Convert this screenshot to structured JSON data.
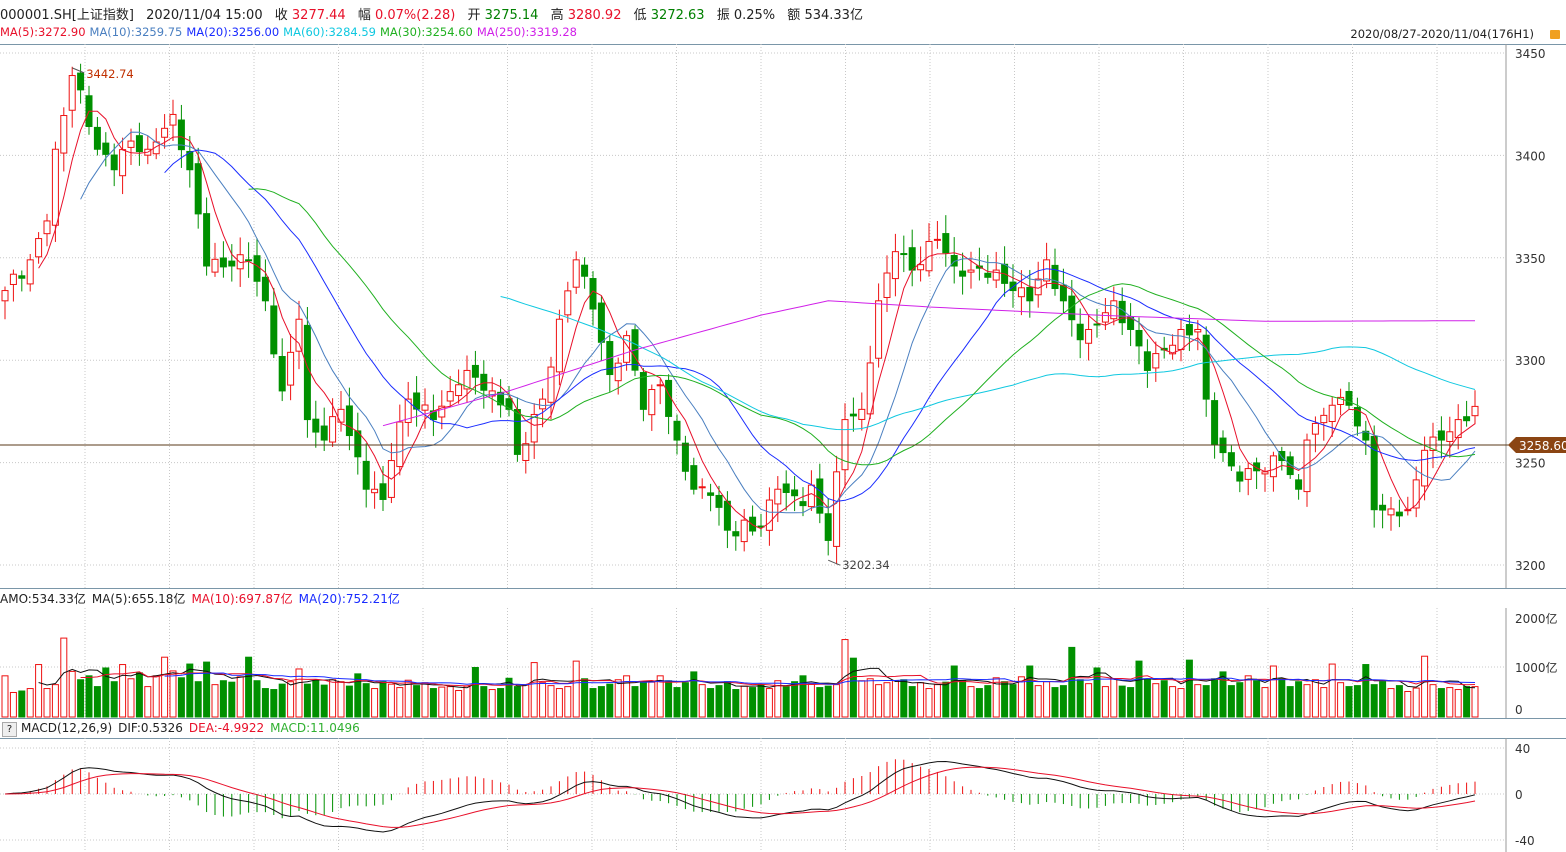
{
  "header": {
    "symbol": "000001.SH[上证指数]",
    "datetime": "2020/11/04 15:00",
    "close_label": "收",
    "close": "3277.44",
    "change_label": "幅",
    "change": "0.07%(2.28)",
    "open_label": "开",
    "open": "3275.14",
    "high_label": "高",
    "high": "3280.92",
    "low_label": "低",
    "low": "3272.63",
    "amp_label": "振",
    "amp": "0.25%",
    "amount_label": "额",
    "amount": "534.33亿"
  },
  "ma_legend": [
    {
      "text": "MA(5):3272.90",
      "color": "#e8102a"
    },
    {
      "text": "MA(10):3259.75",
      "color": "#4a7fc0"
    },
    {
      "text": "MA(20):3256.00",
      "color": "#1a2cff"
    },
    {
      "text": "MA(60):3284.59",
      "color": "#10c8e0"
    },
    {
      "text": "MA(30):3254.60",
      "color": "#20b020"
    },
    {
      "text": "MA(250):3319.28",
      "color": "#d020e8"
    }
  ],
  "range_label": "2020/08/27-2020/11/04(176H1)",
  "current_price_label": "3258.60",
  "current_price": 3258.6,
  "max_marker": {
    "label": "3442.74",
    "bar": 8,
    "price": 3442.74
  },
  "min_marker": {
    "label": "3202.34",
    "bar": 98,
    "price": 3202.34
  },
  "volume_legend": [
    {
      "text": "AMO:534.33亿",
      "color": "#222"
    },
    {
      "text": "MA(5):655.18亿",
      "color": "#222"
    },
    {
      "text": "MA(10):697.87亿",
      "color": "#e8102a"
    },
    {
      "text": "MA(20):752.21亿",
      "color": "#1a2cff"
    }
  ],
  "macd_legend": {
    "help": "?",
    "items": [
      {
        "text": "MACD(12,26,9)",
        "color": "#222"
      },
      {
        "text": "DIF:0.5326",
        "color": "#222"
      },
      {
        "text": "DEA:-4.9922",
        "color": "#e8102a"
      },
      {
        "text": "MACD:11.0496",
        "color": "#30b030"
      }
    ]
  },
  "colors": {
    "up": "#ee1111",
    "down": "#009000",
    "grid": "#c8c8c8",
    "price_tag": "#8b4513"
  },
  "chart_data": {
    "type": "candlestick",
    "bars": 176,
    "price_axis": {
      "ticks": [
        3200,
        3250,
        3300,
        3350,
        3400,
        3450
      ],
      "range": [
        3196,
        3462
      ]
    },
    "volume_axis": {
      "ticks": [
        "0",
        "1000亿",
        "2000亿"
      ],
      "values": [
        0,
        1000,
        2000
      ],
      "max": 2200
    },
    "macd_axis": {
      "ticks": [
        "-40",
        "0",
        "40"
      ],
      "values": [
        -40,
        0,
        40
      ]
    },
    "close_keypoints": [
      [
        0,
        3334
      ],
      [
        3,
        3349
      ],
      [
        5,
        3368
      ],
      [
        6,
        3403
      ],
      [
        8,
        3439
      ],
      [
        9,
        3432
      ],
      [
        11,
        3403
      ],
      [
        13,
        3393
      ],
      [
        15,
        3407
      ],
      [
        17,
        3403
      ],
      [
        20,
        3420
      ],
      [
        22,
        3393
      ],
      [
        24,
        3346
      ],
      [
        27,
        3346
      ],
      [
        29,
        3349
      ],
      [
        31,
        3329
      ],
      [
        33,
        3285
      ],
      [
        35,
        3320
      ],
      [
        36,
        3271
      ],
      [
        38,
        3261
      ],
      [
        40,
        3276
      ],
      [
        43,
        3237
      ],
      [
        45,
        3232
      ],
      [
        46,
        3251
      ],
      [
        48,
        3281
      ],
      [
        51,
        3271
      ],
      [
        54,
        3288
      ],
      [
        55,
        3295
      ],
      [
        58,
        3285
      ],
      [
        60,
        3276
      ],
      [
        61,
        3254
      ],
      [
        64,
        3281
      ],
      [
        66,
        3320
      ],
      [
        68,
        3349
      ],
      [
        70,
        3325
      ],
      [
        72,
        3293
      ],
      [
        74,
        3312
      ],
      [
        76,
        3276
      ],
      [
        78,
        3288
      ],
      [
        80,
        3261
      ],
      [
        82,
        3237
      ],
      [
        84,
        3234
      ],
      [
        86,
        3217
      ],
      [
        90,
        3219
      ],
      [
        92,
        3237
      ],
      [
        95,
        3229
      ],
      [
        96,
        3239
      ],
      [
        98,
        3212
      ],
      [
        100,
        3271
      ],
      [
        102,
        3276
      ],
      [
        104,
        3329
      ],
      [
        106,
        3353
      ],
      [
        108,
        3344
      ],
      [
        111,
        3359
      ],
      [
        113,
        3346
      ],
      [
        115,
        3344
      ],
      [
        118,
        3344
      ],
      [
        120,
        3334
      ],
      [
        122,
        3329
      ],
      [
        124,
        3349
      ],
      [
        126,
        3329
      ],
      [
        128,
        3310
      ],
      [
        129,
        3315
      ],
      [
        132,
        3329
      ],
      [
        134,
        3315
      ],
      [
        136,
        3295
      ],
      [
        138,
        3305
      ],
      [
        140,
        3315
      ],
      [
        142,
        3315
      ],
      [
        143,
        3281
      ],
      [
        144,
        3259
      ],
      [
        147,
        3241
      ],
      [
        149,
        3246
      ],
      [
        152,
        3251
      ],
      [
        154,
        3237
      ],
      [
        155,
        3261
      ],
      [
        158,
        3278
      ],
      [
        160,
        3278
      ],
      [
        162,
        3261
      ],
      [
        163,
        3227
      ],
      [
        166,
        3224
      ],
      [
        167,
        3227
      ],
      [
        169,
        3256
      ],
      [
        171,
        3261
      ],
      [
        173,
        3271
      ],
      [
        175,
        3277.44
      ]
    ],
    "ma250_keypoints": [
      [
        45,
        3268
      ],
      [
        60,
        3285
      ],
      [
        75,
        3305
      ],
      [
        90,
        3322
      ],
      [
        98,
        3329
      ],
      [
        110,
        3326
      ],
      [
        130,
        3322
      ],
      [
        150,
        3319
      ],
      [
        175,
        3319.28
      ]
    ],
    "volume": [
      820,
      480,
      510,
      560,
      1050,
      560,
      640,
      1590,
      910,
      740,
      820,
      600,
      980,
      700,
      1050,
      760,
      880,
      600,
      820,
      1200,
      920,
      780,
      1060,
      700,
      1100,
      640,
      720,
      690,
      800,
      1200,
      720,
      560,
      540,
      650,
      700,
      960,
      650,
      720,
      630,
      740,
      700,
      610,
      860,
      660,
      560,
      700,
      650,
      580,
      730,
      620,
      680,
      560,
      590,
      600,
      520,
      610,
      990,
      600,
      540,
      560,
      770,
      600,
      630,
      1090,
      680,
      620,
      560,
      600,
      1120,
      760,
      560,
      600,
      650,
      740,
      820,
      600,
      700,
      690,
      820,
      720,
      580,
      680,
      900,
      640,
      560,
      620,
      700,
      540,
      610,
      580,
      640,
      560,
      720,
      600,
      700,
      820,
      650,
      580,
      610,
      640,
      1560,
      1180,
      720,
      760,
      640,
      680,
      720,
      740,
      600,
      680,
      560,
      640,
      690,
      1020,
      720,
      600,
      560,
      620,
      780,
      700,
      640,
      800,
      1020,
      620,
      700,
      580,
      620,
      1400,
      740,
      660,
      980,
      600,
      760,
      610,
      580,
      1120,
      750,
      660,
      720,
      600,
      560,
      1140,
      640,
      620,
      760,
      900,
      620,
      680,
      820,
      720,
      580,
      1020,
      760,
      600,
      700,
      640,
      740,
      580,
      1060,
      680,
      600,
      620,
      1050,
      640,
      700,
      560,
      620,
      500,
      570,
      1220,
      640,
      560,
      580,
      540
    ]
  }
}
